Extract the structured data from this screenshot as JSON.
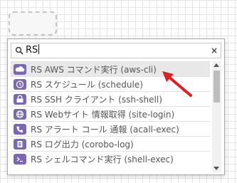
{
  "search": {
    "value": "RS",
    "clear_label": "×"
  },
  "colors": {
    "icon_purple": "#7b68b4",
    "highlight": "#e8e8e8",
    "annotation_arrow": "#e02020"
  },
  "items": [
    {
      "label": "RS AWS コマンド実行 (aws-cli)",
      "icon": "cloud-icon",
      "highlighted": true
    },
    {
      "label": "RS スケジュール (schedule)",
      "icon": "clock-icon"
    },
    {
      "label": "RS SSH クライアント (ssh-shell)",
      "icon": "ssh-icon"
    },
    {
      "label": "RS Webサイト 情報取得 (site-login)",
      "icon": "web-icon"
    },
    {
      "label": "RS アラート コール 通報 (acall-exec)",
      "icon": "phone-icon"
    },
    {
      "label": "RS ログ出力 (corobo-log)",
      "icon": "log-icon"
    },
    {
      "label": "RS シェルコマンド実行 (shell-exec)",
      "icon": "shell-icon"
    }
  ]
}
